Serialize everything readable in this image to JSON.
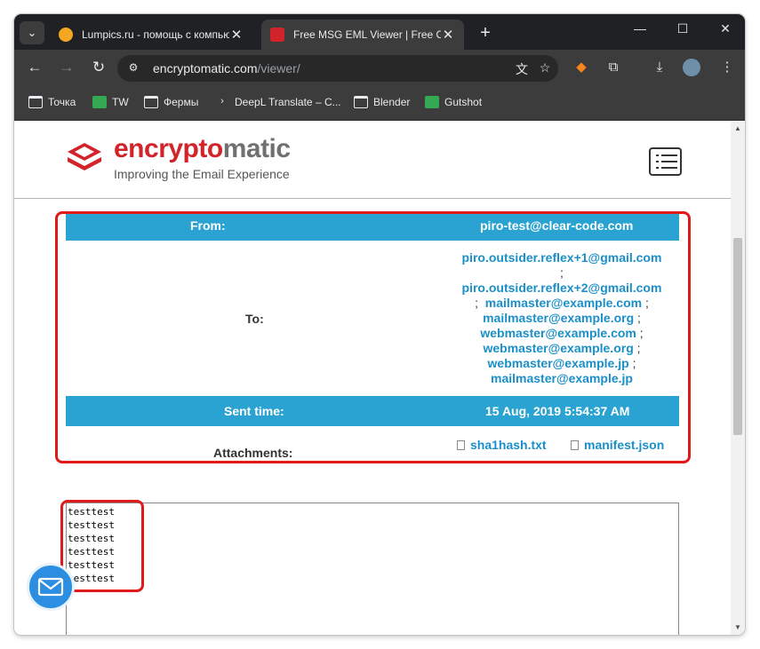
{
  "browser": {
    "tabs": [
      {
        "title": "Lumpics.ru - помощь с компьютером",
        "favicon_color": "#f5a623",
        "active": false
      },
      {
        "title": "Free MSG EML Viewer | Free Online",
        "favicon_color": "#d2232a",
        "active": true
      }
    ],
    "url_host": "encryptomatic.com",
    "url_path": "/viewer/",
    "bookmarks": [
      "Точка",
      "TW",
      "Фермы",
      "DeepL Translate – C...",
      "Blender",
      "Gutshot"
    ]
  },
  "site": {
    "logo_red": "encrypto",
    "logo_gray": "matic",
    "tagline": "Improving the Email Experience"
  },
  "email": {
    "from_label": "From:",
    "from_value": "piro-test@clear-code.com",
    "to_label": "To:",
    "to_addresses": [
      "piro.outsider.reflex+1@gmail.com",
      "piro.outsider.reflex+2@gmail.com",
      "mailmaster@example.com",
      "mailmaster@example.org",
      "webmaster@example.com",
      "webmaster@example.org",
      "webmaster@example.jp",
      "mailmaster@example.jp"
    ],
    "separator": ";",
    "sent_label": "Sent time:",
    "sent_value": "15 Aug, 2019 5:54:37 AM",
    "attachments_label": "Attachments:",
    "attachments": [
      "sha1hash.txt",
      "manifest.json"
    ],
    "body_lines": [
      "testtest",
      "testtest",
      "testtest",
      "testtest",
      "testtest",
      "testtest"
    ]
  },
  "colors": {
    "header_blue": "#2ba3d2",
    "link_blue": "#1a8fc9",
    "brand_red": "#d2232a",
    "highlight_red": "#e01a1a"
  }
}
